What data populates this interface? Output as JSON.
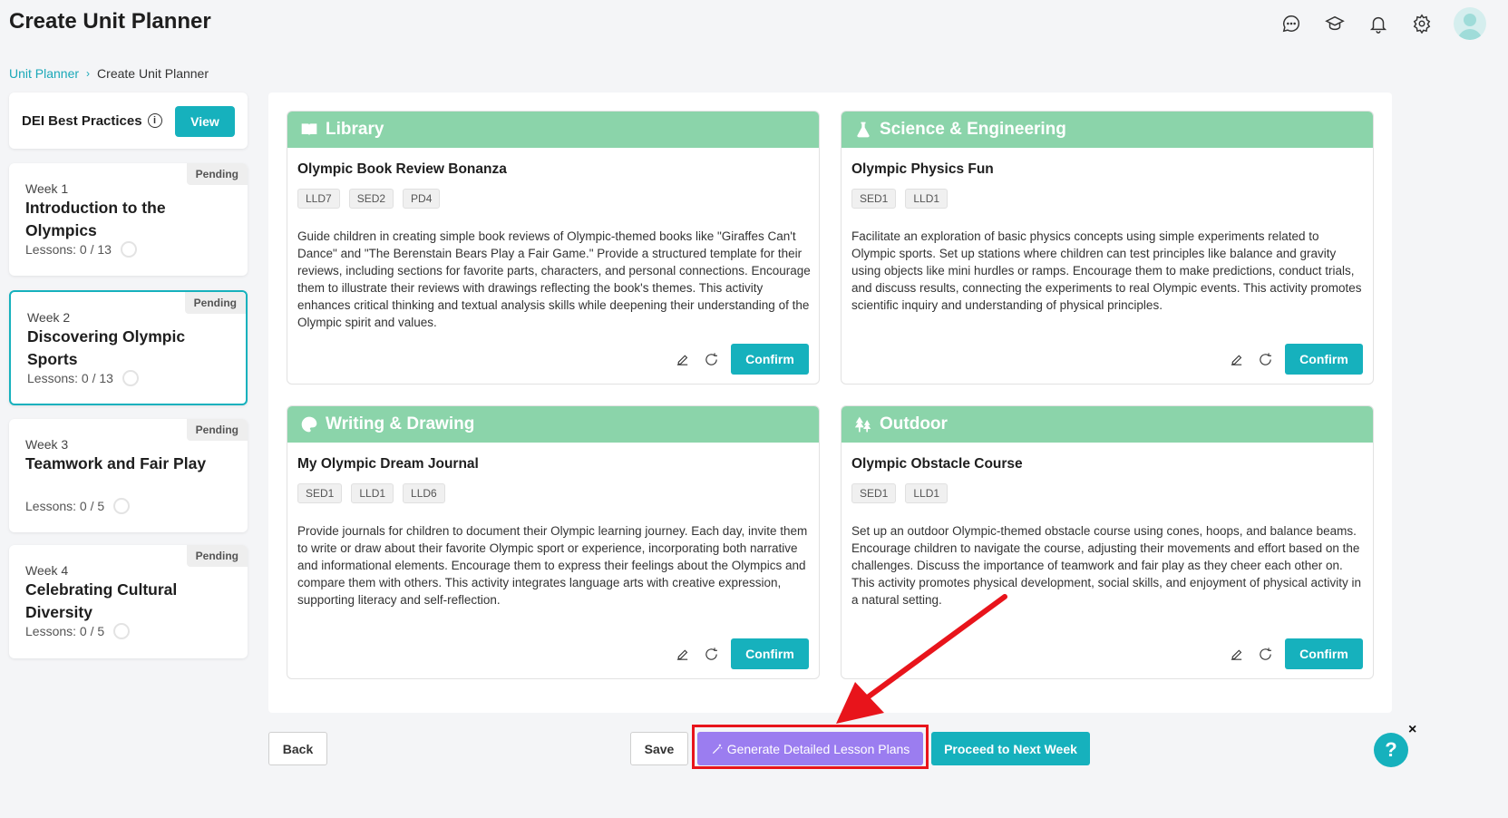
{
  "page": {
    "title": "Create Unit Planner"
  },
  "breadcrumb": {
    "parent": "Unit Planner",
    "current": "Create Unit Planner"
  },
  "header_icons": [
    "chat-icon",
    "graduation-cap-icon",
    "bell-icon",
    "gear-icon",
    "avatar"
  ],
  "dei": {
    "label": "DEI Best Practices",
    "info": "i",
    "view_label": "View"
  },
  "weeks": [
    {
      "week": "Week 1",
      "title": "Introduction to the Olympics",
      "lessons": "Lessons: 0 / 13",
      "status": "Pending"
    },
    {
      "week": "Week 2",
      "title": "Discovering Olympic Sports",
      "lessons": "Lessons: 0 / 13",
      "status": "Pending"
    },
    {
      "week": "Week 3",
      "title": "Teamwork and Fair Play",
      "lessons": "Lessons: 0 / 5",
      "status": "Pending"
    },
    {
      "week": "Week 4",
      "title": "Celebrating Cultural Diversity",
      "lessons": "Lessons: 0 / 5",
      "status": "Pending"
    }
  ],
  "activities": [
    {
      "category": "Library",
      "icon": "book-icon",
      "title": "Olympic Book Review Bonanza",
      "tags": [
        "LLD7",
        "SED2",
        "PD4"
      ],
      "description": "Guide children in creating simple book reviews of Olympic-themed books like \"Giraffes Can't Dance\" and \"The Berenstain Bears Play a Fair Game.\" Provide a structured template for their reviews, including sections for favorite parts, characters, and personal connections. Encourage them to illustrate their reviews with drawings reflecting the book's themes. This activity enhances critical thinking and textual analysis skills while deepening their understanding of the Olympic spirit and values.",
      "confirm_label": "Confirm"
    },
    {
      "category": "Science & Engineering",
      "icon": "flask-icon",
      "title": "Olympic Physics Fun",
      "tags": [
        "SED1",
        "LLD1"
      ],
      "description": "Facilitate an exploration of basic physics concepts using simple experiments related to Olympic sports. Set up stations where children can test principles like balance and gravity using objects like mini hurdles or ramps. Encourage them to make predictions, conduct trials, and discuss results, connecting the experiments to real Olympic events. This activity promotes scientific inquiry and understanding of physical principles.",
      "confirm_label": "Confirm"
    },
    {
      "category": "Writing & Drawing",
      "icon": "palette-icon",
      "title": "My Olympic Dream Journal",
      "tags": [
        "SED1",
        "LLD1",
        "LLD6"
      ],
      "description": "Provide journals for children to document their Olympic learning journey. Each day, invite them to write or draw about their favorite Olympic sport or experience, incorporating both narrative and informational elements. Encourage them to express their feelings about the Olympics and compare them with others. This activity integrates language arts with creative expression, supporting literacy and self-reflection.",
      "confirm_label": "Confirm"
    },
    {
      "category": "Outdoor",
      "icon": "trees-icon",
      "title": "Olympic Obstacle Course",
      "tags": [
        "SED1",
        "LLD1"
      ],
      "description": "Set up an outdoor Olympic-themed obstacle course using cones, hoops, and balance beams. Encourage children to navigate the course, adjusting their movements and effort based on the challenges. Discuss the importance of teamwork and fair play as they cheer each other on. This activity promotes physical development, social skills, and enjoyment of physical activity in a natural setting.",
      "confirm_label": "Confirm"
    }
  ],
  "footer": {
    "back_label": "Back",
    "save_label": "Save",
    "generate_label": "Generate Detailed Lesson Plans",
    "next_label": "Proceed to Next Week"
  },
  "help": {
    "label": "?",
    "close": "×"
  },
  "colors": {
    "accent": "#16b1bd",
    "header_green": "#8bd4aa",
    "generate_purple": "#9b7df0",
    "highlight_red": "#e8141b"
  }
}
